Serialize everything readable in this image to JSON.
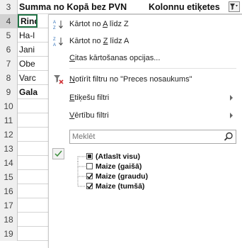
{
  "rows": [
    {
      "num": "3",
      "text": ""
    },
    {
      "num": "4",
      "text": "Rind"
    },
    {
      "num": "5",
      "text": "Ha-l"
    },
    {
      "num": "6",
      "text": "Jani"
    },
    {
      "num": "7",
      "text": "Obe"
    },
    {
      "num": "8",
      "text": "Varc"
    },
    {
      "num": "9",
      "text": "Gala"
    },
    {
      "num": "10",
      "text": ""
    },
    {
      "num": "11",
      "text": ""
    },
    {
      "num": "12",
      "text": ""
    },
    {
      "num": "13",
      "text": ""
    },
    {
      "num": "14",
      "text": ""
    },
    {
      "num": "15",
      "text": ""
    },
    {
      "num": "16",
      "text": ""
    },
    {
      "num": "17",
      "text": ""
    },
    {
      "num": "18",
      "text": ""
    },
    {
      "num": "19",
      "text": ""
    }
  ],
  "header": {
    "values_label": "Summa no Kopā bez PVN",
    "columns_label": "Kolonnu etiķetes"
  },
  "menu": {
    "sort_az": {
      "pre": "Kārtot no ",
      "u": "A",
      "post": " līdz Z"
    },
    "sort_za": {
      "pre": "Kārtot no ",
      "u": "Z",
      "post": " līdz A"
    },
    "more_sort": {
      "pre": "",
      "u": "C",
      "post": "itas kārtošanas opcijas..."
    },
    "clear_filter": {
      "pre": "",
      "u": "N",
      "post": "otīrīt filtru no \"Preces nosaukums\""
    },
    "label_filters": {
      "pre": "",
      "u": "E",
      "post": "tiķešu filtri"
    },
    "value_filters": {
      "pre": "",
      "u": "V",
      "post": "ērtību filtri"
    },
    "search_placeholder": "Meklēt"
  },
  "filter_list": [
    {
      "label": "(Atlasīt visu)",
      "state": "partial"
    },
    {
      "label": "Maize (gaišā)",
      "state": "unchecked"
    },
    {
      "label": "Maize (graudu)",
      "state": "checked"
    },
    {
      "label": "Maize (tumšā)",
      "state": "checked"
    }
  ],
  "colors": {
    "accent": "#217346",
    "sort_icon_blue": "#2f6fb7",
    "clear_icon_red": "#d13438"
  }
}
